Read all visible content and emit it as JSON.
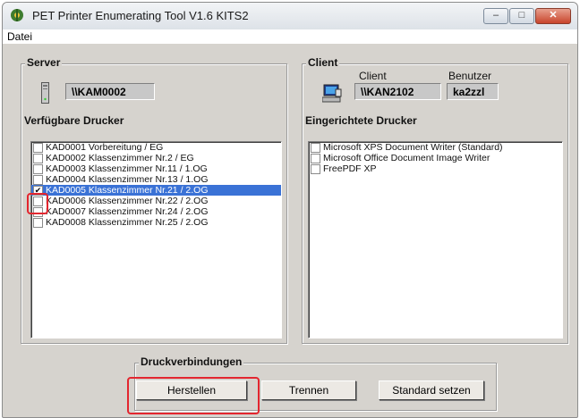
{
  "window": {
    "title": "PET   Printer Enumerating Tool  V1.6  KITS2",
    "buttons": [
      "minimize-icon",
      "maximize-icon",
      "close-icon"
    ]
  },
  "menu": {
    "items": [
      "Datei"
    ]
  },
  "server": {
    "group_title": "Server",
    "name": "\\\\KAM0002",
    "printers_label": "Verfügbare Drucker",
    "printers": [
      {
        "label": "KAD0001 Vorbereitung / EG",
        "checked": false,
        "selected": false
      },
      {
        "label": "KAD0002 Klassenzimmer Nr.2 / EG",
        "checked": false,
        "selected": false
      },
      {
        "label": "KAD0003 Klassenzimmer Nr.11 / 1.OG",
        "checked": false,
        "selected": false
      },
      {
        "label": "KAD0004 Klassenzimmer Nr.13 / 1.OG",
        "checked": false,
        "selected": false
      },
      {
        "label": "KAD0005 Klassenzimmer Nr.21 / 2.OG",
        "checked": true,
        "selected": true
      },
      {
        "label": "KAD0006 Klassenzimmer Nr.22 / 2.OG",
        "checked": false,
        "selected": false
      },
      {
        "label": "KAD0007 Klassenzimmer Nr.24 / 2.OG",
        "checked": false,
        "selected": false
      },
      {
        "label": "KAD0008 Klassenzimmer Nr.25 / 2.OG",
        "checked": false,
        "selected": false
      }
    ]
  },
  "client": {
    "group_title": "Client",
    "client_label": "Client",
    "user_label": "Benutzer",
    "name": "\\\\KAN2102",
    "user": "ka2zzl",
    "printers_label": "Eingerichtete Drucker",
    "printers": [
      {
        "label": "Microsoft XPS Document Writer (Standard)",
        "checked": false
      },
      {
        "label": "Microsoft Office Document Image Writer",
        "checked": false
      },
      {
        "label": "FreePDF XP",
        "checked": false
      }
    ]
  },
  "connections": {
    "group_title": "Druckverbindungen",
    "buttons": {
      "create": "Herstellen",
      "disconnect": "Trennen",
      "set_default": "Standard setzen"
    }
  },
  "colors": {
    "dialog_bg": "#d6d3ce",
    "selection": "#3a72d6",
    "highlight": "#e3262f"
  }
}
